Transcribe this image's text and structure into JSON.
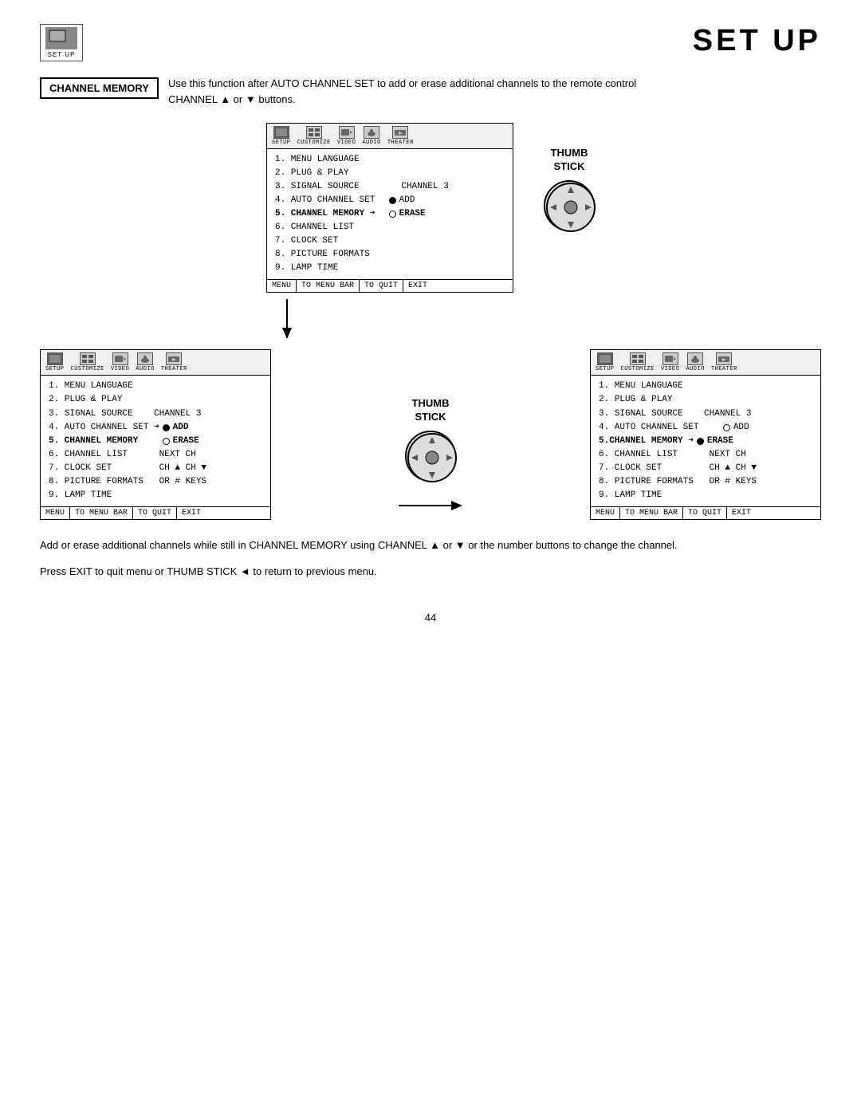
{
  "page": {
    "title": "SET UP",
    "number": "44"
  },
  "setup_icon": {
    "label": "SET UP"
  },
  "channel_memory": {
    "label": "CHANNEL MEMORY",
    "description": "Use this function after AUTO CHANNEL SET to add or erase additional channels to the remote control CHANNEL ▲ or ▼ buttons."
  },
  "toolbar": {
    "items": [
      "SETUP",
      "CUSTOMIZE",
      "VIDEO",
      "AUDIO",
      "THEATER"
    ]
  },
  "top_menu": {
    "items": [
      "1. MENU LANGUAGE",
      "2. PLUG & PLAY",
      "3. SIGNAL SOURCE         CHANNEL 3",
      "4. AUTO CHANNEL SET",
      "5. CHANNEL MEMORY",
      "6. CHANNEL LIST",
      "7. CLOCK SET",
      "8. PICTURE FORMATS",
      "9. LAMP TIME"
    ],
    "item4_add": "●ADD",
    "item5_arrow": "➡",
    "item5_erase": "○ERASE",
    "footer": [
      "MENU",
      "TO MENU BAR",
      "TO QUIT",
      "EXIT"
    ]
  },
  "bottom_left_menu": {
    "items": [
      "1. MENU LANGUAGE",
      "2. PLUG & PLAY",
      "3. SIGNAL SOURCE         CHANNEL 3",
      "4. AUTO CHANNEL SET",
      "5. CHANNEL MEMORY",
      "6. CHANNEL LIST           NEXT CH",
      "7. CLOCK SET               CH ▲ CH ▼",
      "8. PICTURE FORMATS    OR # KEYS",
      "9. LAMP TIME"
    ],
    "item4_add": "➡●ADD",
    "item5_erase": "○ERASE",
    "footer": [
      "MENU",
      "TO MENU BAR",
      "TO QUIT",
      "EXIT"
    ]
  },
  "bottom_right_menu": {
    "items": [
      "1. MENU LANGUAGE",
      "2. PLUG & PLAY",
      "3. SIGNAL SOURCE         CHANNEL 3",
      "4. AUTO CHANNEL SET           ○ADD",
      "5. CHANNEL MEMORY",
      "6. CHANNEL LIST           NEXT CH",
      "7. CLOCK SET               CH ▲ CH ▼",
      "8. PICTURE FORMATS    OR # KEYS",
      "9. LAMP TIME"
    ],
    "item5_erase": "➡●ERASE",
    "footer": [
      "MENU",
      "TO MENU BAR",
      "TO QUIT",
      "EXIT"
    ]
  },
  "thumb_stick": {
    "label": "THUMB\nSTICK"
  },
  "description1": "Add or erase additional channels while still in CHANNEL MEMORY using CHANNEL ▲ or ▼ or the number buttons to change the channel.",
  "description2": "Press EXIT to quit menu or THUMB STICK ◄ to return to previous menu."
}
